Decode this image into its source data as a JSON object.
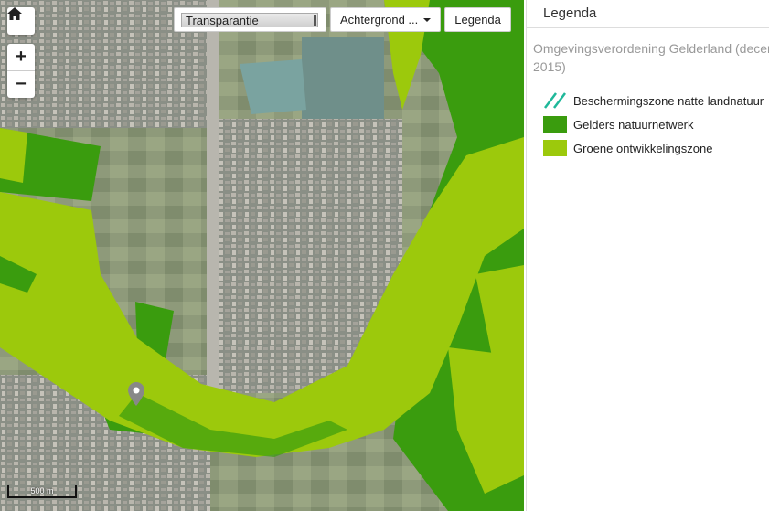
{
  "map": {
    "home_icon": "home-icon",
    "zoom_in_label": "+",
    "zoom_out_label": "−",
    "transparency_label": "Transparantie",
    "background_label": "Achtergrond ...",
    "legend_button_label": "Legenda",
    "scale_label": "500 m",
    "marker_icon": "map-marker-icon"
  },
  "panel": {
    "title": "Legenda",
    "subtitle_line1": "Omgevingsverordening Gelderland (decem",
    "subtitle_line2": "2015)",
    "items": [
      {
        "label": "Beschermingszone natte landnatuur",
        "color": "#1fb89a",
        "style": "hatch"
      },
      {
        "label": "Gelders natuurnetwerk",
        "color": "#3a9c0e",
        "style": "fill"
      },
      {
        "label": "Groene ontwikkelingszone",
        "color": "#9cc90c",
        "style": "fill"
      }
    ]
  }
}
